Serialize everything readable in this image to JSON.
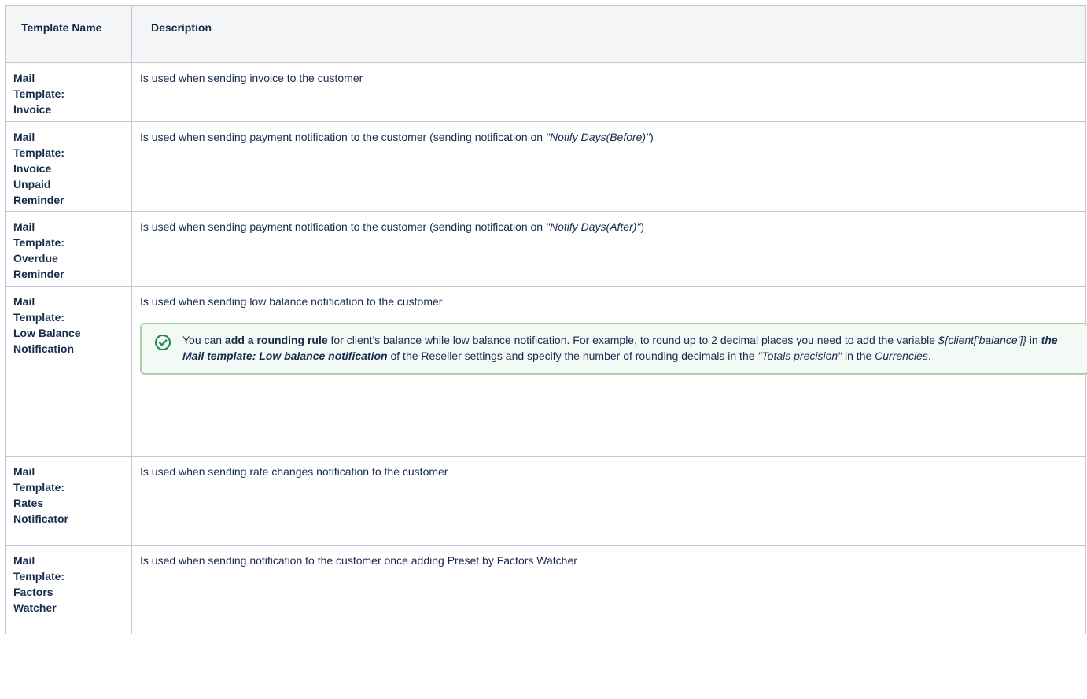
{
  "table": {
    "headers": {
      "template_name": "Template Name",
      "description": "Description"
    },
    "rows": [
      {
        "name_lines": [
          "Mail",
          "Template:",
          "Invoice"
        ],
        "description": "Is used when sending invoice to the customer"
      },
      {
        "name_lines": [
          "Mail",
          "Template:",
          "Invoice",
          "Unpaid",
          "Reminder"
        ],
        "description_prefix": "Is used when sending payment notification to the customer (sending notification on ",
        "description_em": "\"Notify Days(Before)\"",
        "description_suffix": ")"
      },
      {
        "name_lines": [
          "Mail",
          "Template:",
          "Overdue",
          "Reminder"
        ],
        "description_prefix": "Is used when sending payment notification to the customer (sending notification on ",
        "description_em": "\"Notify Days(After)\"",
        "description_suffix": ")"
      },
      {
        "name_lines": [
          "Mail",
          "Template:",
          "Low Balance",
          "Notification"
        ],
        "description": "Is used when sending low balance notification to the customer",
        "note": {
          "icon": "check-circle-icon",
          "t1": "You can ",
          "b1": "add a rounding rule",
          "t2": " for client's balance while low balance notification.  For example, to round up to 2 decimal places you need to add the variable ",
          "i1": "${client['balance']}",
          "t3": " in ",
          "bi1": "the Mail template: Low balance notification",
          "t4": " of the Reseller settings and specify the number of rounding decimals in the ",
          "i2": "\"Totals precision\"",
          "t5": " in the ",
          "i3": "Currencies",
          "t6": "."
        }
      },
      {
        "name_lines": [
          "Mail",
          "Template:",
          "Rates",
          "Notificator"
        ],
        "description": "Is used when sending rate changes notification to the customer"
      },
      {
        "name_lines": [
          "Mail",
          "Template:",
          "Factors",
          "Watcher"
        ],
        "description": "Is used when sending notification to the customer once adding Preset by Factors Watcher"
      }
    ]
  },
  "colors": {
    "border": "#c1c7d0",
    "header_bg": "#f4f5f7",
    "note_border": "#a8d3aa",
    "note_bg": "#f3f9f4",
    "check_icon": "#1f845a"
  }
}
